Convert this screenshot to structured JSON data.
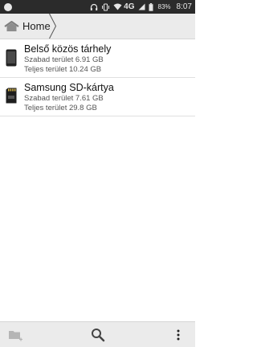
{
  "status_bar": {
    "network": "4G",
    "battery_percent": "83%",
    "time": "8:07",
    "icons": [
      "notification-dot-icon",
      "headphones-icon",
      "vibrate-icon",
      "wifi-icon",
      "cell-signal-icon",
      "battery-icon"
    ]
  },
  "breadcrumb": {
    "home_label": "Home",
    "icons": [
      "home-icon",
      "chevron-separator-icon"
    ]
  },
  "storage": {
    "items": [
      {
        "name": "Belső közös tárhely",
        "free": "Szabad terület 6.91 GB",
        "total": "Teljes terület 10.24 GB",
        "icon": "phone-icon"
      },
      {
        "name": "Samsung SD-kártya",
        "free": "Szabad terület 7.61 GB",
        "total": "Teljes terület 29.8 GB",
        "icon": "sd-card-icon"
      }
    ]
  },
  "toolbar": {
    "icons": [
      "new-folder-icon",
      "search-icon",
      "more-vertical-icon"
    ]
  },
  "colors": {
    "status_bar": "#2b2b2b",
    "toolbar_bg": "#ebebeb",
    "text_primary": "#111111",
    "text_secondary": "#555555"
  }
}
